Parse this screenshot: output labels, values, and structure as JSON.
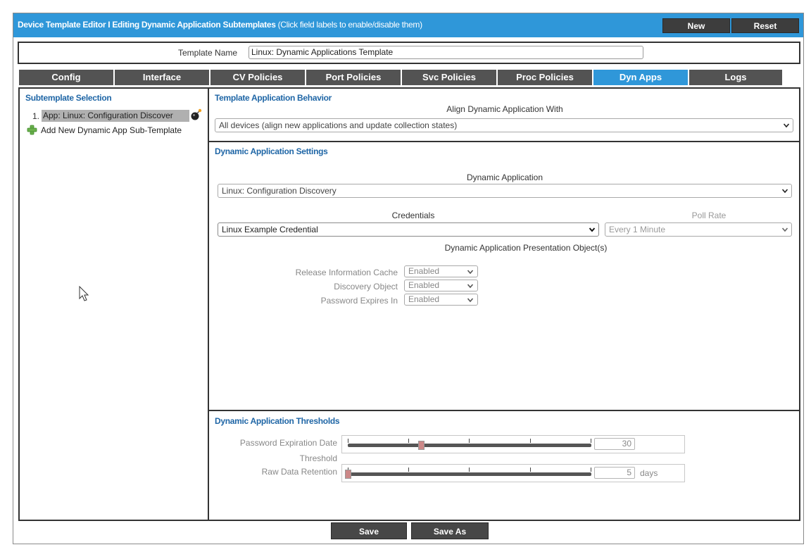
{
  "header": {
    "title_bold": "Device Template Editor I Editing Dynamic Application Subtemplates",
    "title_note": " (Click field labels to enable/disable them)",
    "new_label": "New",
    "reset_label": "Reset"
  },
  "template": {
    "name_label": "Template Name",
    "name_value": "Linux: Dynamic Applications Template"
  },
  "tabs": [
    {
      "label": "Config"
    },
    {
      "label": "Interface"
    },
    {
      "label": "CV Policies"
    },
    {
      "label": "Port Policies"
    },
    {
      "label": "Svc Policies"
    },
    {
      "label": "Proc Policies"
    },
    {
      "label": "Dyn Apps",
      "active": true
    },
    {
      "label": "Logs"
    }
  ],
  "subtemplate": {
    "heading": "Subtemplate Selection",
    "item_number": "1.",
    "item_label": "App: Linux: Configuration Discover",
    "add_label": "Add New Dynamic App Sub-Template"
  },
  "behavior": {
    "heading": "Template Application Behavior",
    "align_label": "Align Dynamic Application With",
    "align_value": "All devices (align new applications and update collection states)"
  },
  "settings": {
    "heading": "Dynamic Application Settings",
    "app_label": "Dynamic Application",
    "app_value": "Linux: Configuration Discovery",
    "cred_label": "Credentials",
    "cred_value": "Linux Example Credential",
    "poll_label": "Poll Rate",
    "poll_value": "Every 1 Minute",
    "presentation_label": "Dynamic Application Presentation Object(s)",
    "objects": [
      {
        "label": "Release Information Cache",
        "value": "Enabled"
      },
      {
        "label": "Discovery Object",
        "value": "Enabled"
      },
      {
        "label": "Password Expires In",
        "value": "Enabled"
      }
    ]
  },
  "thresholds": {
    "heading": "Dynamic Application Thresholds",
    "pwd_label": "Password Expiration Date",
    "pwd_value": "30",
    "pwd_fraction": 0.3,
    "threshold_label": "Threshold",
    "raw_label": "Raw Data Retention",
    "raw_value": "5",
    "raw_unit": "days",
    "raw_fraction": 0.0
  },
  "footer": {
    "save_label": "Save",
    "save_as_label": "Save As"
  },
  "colors": {
    "accent": "#2f97d9",
    "tab": "#535353",
    "section": "#1f66a6"
  }
}
